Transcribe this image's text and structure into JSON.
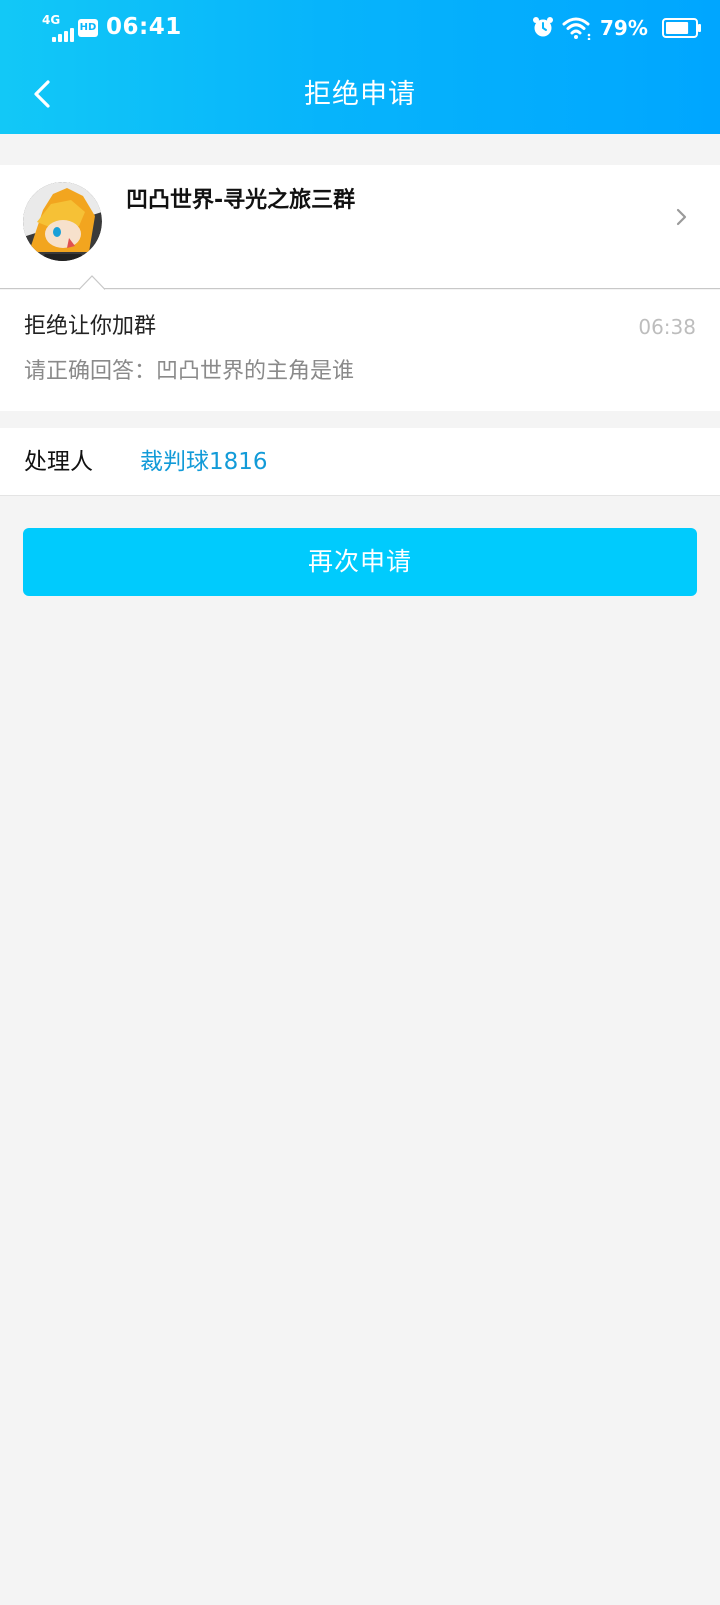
{
  "status_bar": {
    "network": "4G",
    "hd_badge": "HD",
    "time": "06:41",
    "battery_percent": "79%",
    "battery_level": 0.79,
    "icons": [
      "signal-icon",
      "hd-icon",
      "alarm-icon",
      "wifi-icon",
      "battery-icon"
    ]
  },
  "header": {
    "title": "拒绝申请",
    "back_icon": "chevron-left-icon"
  },
  "group": {
    "name": "凹凸世界-寻光之旅三群",
    "avatar_icon": "group-avatar",
    "chevron_icon": "chevron-right-icon"
  },
  "message": {
    "title": "拒绝让你加群",
    "time": "06:38",
    "detail": "请正确回答：凹凸世界的主角是谁"
  },
  "handler": {
    "label": "处理人",
    "name": "裁判球1816"
  },
  "actions": {
    "reapply_label": "再次申请"
  },
  "colors": {
    "header_gradient_start": "#12c8f7",
    "header_gradient_end": "#00a6ff",
    "button": "#00cbfd",
    "link": "#129bd8",
    "background": "#f4f4f4"
  }
}
